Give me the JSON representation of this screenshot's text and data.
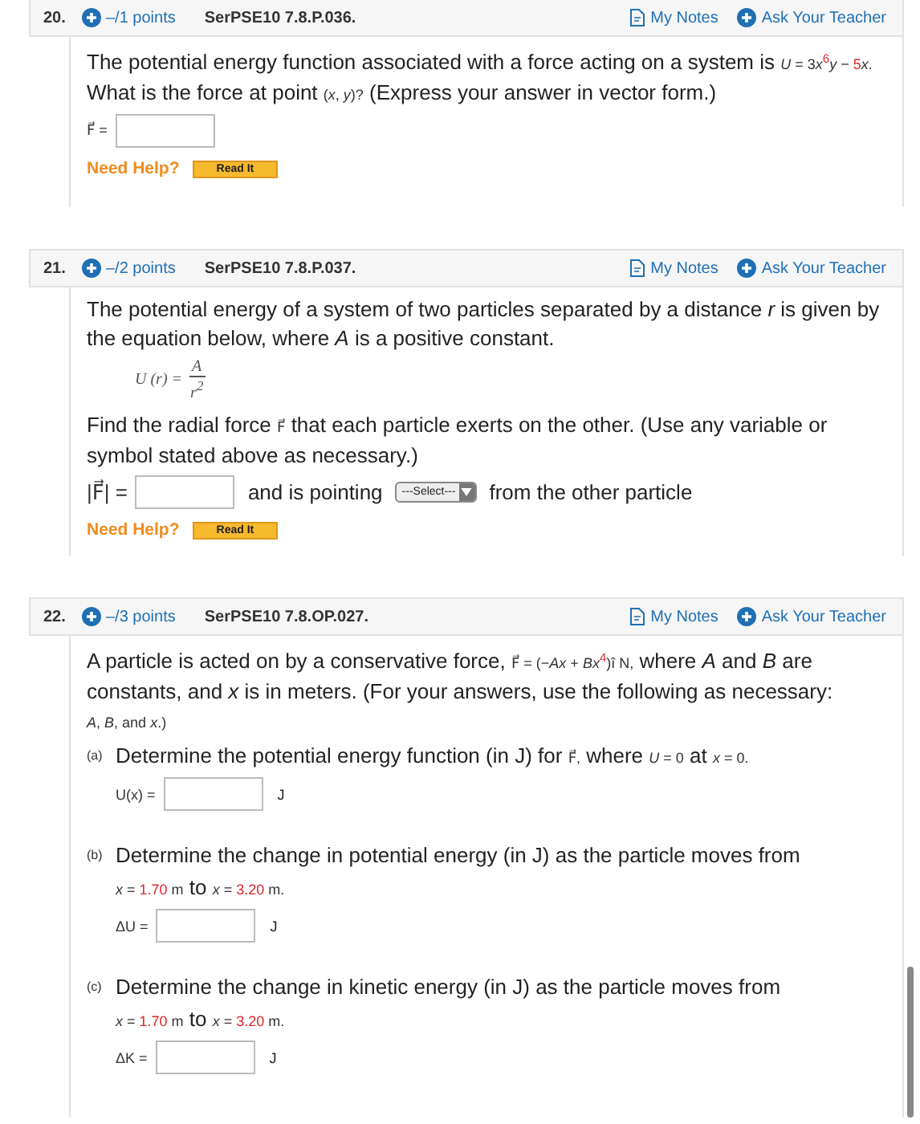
{
  "questions": [
    {
      "number": "20.",
      "points": "–/1 points",
      "code": "SerPSE10 7.8.P.036.",
      "notes": "My Notes",
      "ask": "Ask Your Teacher",
      "blocks": [
        {
          "kind": "para",
          "segments": [
            {
              "kind": "text",
              "t": "The potential energy function associated with a force acting on a system is "
            },
            {
              "kind": "math",
              "t": "*U* = 3"
            },
            {
              "kind": "math",
              "t": "*x*"
            },
            {
              "kind": "math-red",
              "t": "$^{6}$"
            },
            {
              "kind": "math",
              "t": "*y* − "
            },
            {
              "kind": "math-red",
              "t": "5"
            },
            {
              "kind": "math",
              "t": "*x*."
            },
            {
              "kind": "text",
              "t": " What is the force at point "
            },
            {
              "kind": "math",
              "t": "(*x*, *y*)?"
            },
            {
              "kind": "text",
              "t": " (Express your answer in vector form.)"
            }
          ]
        },
        {
          "kind": "answer",
          "items": [
            {
              "kind": "label",
              "text": "F⃗ ="
            },
            {
              "kind": "field"
            }
          ]
        },
        {
          "kind": "help",
          "label": "Need Help?",
          "button": "Read It"
        }
      ]
    },
    {
      "number": "21.",
      "points": "–/2 points",
      "code": "SerPSE10 7.8.P.037.",
      "notes": "My Notes",
      "ask": "Ask Your Teacher",
      "blocks": [
        {
          "kind": "para",
          "segments": [
            {
              "kind": "text",
              "t": "The potential energy of a system of two particles separated by a distance *r* is given by the equation below, where *A* is a positive constant."
            }
          ]
        },
        {
          "kind": "formula",
          "label": "U (r) =",
          "numerator": "A",
          "denominator": "r$^{2}$"
        },
        {
          "kind": "para",
          "segments": [
            {
              "kind": "text",
              "t": "Find the radial force "
            },
            {
              "kind": "math",
              "t": "F⃗"
            },
            {
              "kind": "text",
              "t": " that each particle exerts on the other. (Use any variable or symbol stated above as necessary.)"
            }
          ]
        },
        {
          "kind": "answer",
          "items": [
            {
              "kind": "label-large",
              "text": "|F⃗| ="
            },
            {
              "kind": "field"
            },
            {
              "kind": "text",
              "text": "and is pointing"
            },
            {
              "kind": "select",
              "text": "---Select---"
            },
            {
              "kind": "text",
              "text": "from the other particle"
            }
          ]
        },
        {
          "kind": "help",
          "label": "Need Help?",
          "button": "Read It"
        }
      ]
    },
    {
      "number": "22.",
      "points": "–/3 points",
      "code": "SerPSE10 7.8.OP.027.",
      "notes": "My Notes",
      "ask": "Ask Your Teacher",
      "blocks": [
        {
          "kind": "para",
          "segments": [
            {
              "kind": "text",
              "t": "A particle is acted on by a conservative force, "
            },
            {
              "kind": "math",
              "t": "F⃗ = (−*Ax* + *Bx*"
            },
            {
              "kind": "math-red",
              "t": "$^{4}$"
            },
            {
              "kind": "math",
              "t": ")î N,"
            },
            {
              "kind": "text",
              "t": " where *A* and *B* are constants, and *x* is in meters. (For your answers, use the following as necessary: "
            },
            {
              "kind": "math",
              "t": "*A*, *B*, and *x*.)"
            }
          ]
        },
        {
          "kind": "part",
          "letter": "(a)",
          "blocks": [
            {
              "kind": "para",
              "segments": [
                {
                  "kind": "text",
                  "t": "Determine the potential energy function (in J) for "
                },
                {
                  "kind": "math",
                  "t": "F⃗,"
                },
                {
                  "kind": "text",
                  "t": " where "
                },
                {
                  "kind": "math",
                  "t": "*U* = 0"
                },
                {
                  "kind": "text",
                  "t": " at "
                },
                {
                  "kind": "math",
                  "t": "*x* = 0."
                }
              ]
            },
            {
              "kind": "answer",
              "items": [
                {
                  "kind": "label",
                  "text": "U(x) ="
                },
                {
                  "kind": "field"
                },
                {
                  "kind": "unit",
                  "text": "J"
                }
              ]
            }
          ]
        },
        {
          "kind": "part",
          "letter": "(b)",
          "blocks": [
            {
              "kind": "para",
              "segments": [
                {
                  "kind": "text",
                  "t": "Determine the change in potential energy (in J) as the particle moves from"
                }
              ]
            },
            {
              "kind": "para",
              "segments": [
                {
                  "kind": "math",
                  "t": "*x* = "
                },
                {
                  "kind": "math-red",
                  "t": "1.70"
                },
                {
                  "kind": "math",
                  "t": " m"
                },
                {
                  "kind": "text",
                  "t": " to "
                },
                {
                  "kind": "math",
                  "t": "*x* = "
                },
                {
                  "kind": "math-red",
                  "t": "3.20"
                },
                {
                  "kind": "math",
                  "t": " m."
                }
              ]
            },
            {
              "kind": "answer",
              "items": [
                {
                  "kind": "label",
                  "text": "ΔU ="
                },
                {
                  "kind": "field"
                },
                {
                  "kind": "unit",
                  "text": "J"
                }
              ]
            }
          ]
        },
        {
          "kind": "part",
          "letter": "(c)",
          "blocks": [
            {
              "kind": "para",
              "segments": [
                {
                  "kind": "text",
                  "t": "Determine the change in kinetic energy (in J) as the particle moves from"
                }
              ]
            },
            {
              "kind": "para",
              "segments": [
                {
                  "kind": "math",
                  "t": "*x* = "
                },
                {
                  "kind": "math-red",
                  "t": "1.70"
                },
                {
                  "kind": "math",
                  "t": " m"
                },
                {
                  "kind": "text",
                  "t": " to "
                },
                {
                  "kind": "math",
                  "t": "*x* = "
                },
                {
                  "kind": "math-red",
                  "t": "3.20"
                },
                {
                  "kind": "math",
                  "t": " m."
                }
              ]
            },
            {
              "kind": "answer",
              "items": [
                {
                  "kind": "label",
                  "text": "ΔK ="
                },
                {
                  "kind": "field"
                },
                {
                  "kind": "unit",
                  "text": "J"
                }
              ]
            }
          ]
        }
      ]
    }
  ]
}
